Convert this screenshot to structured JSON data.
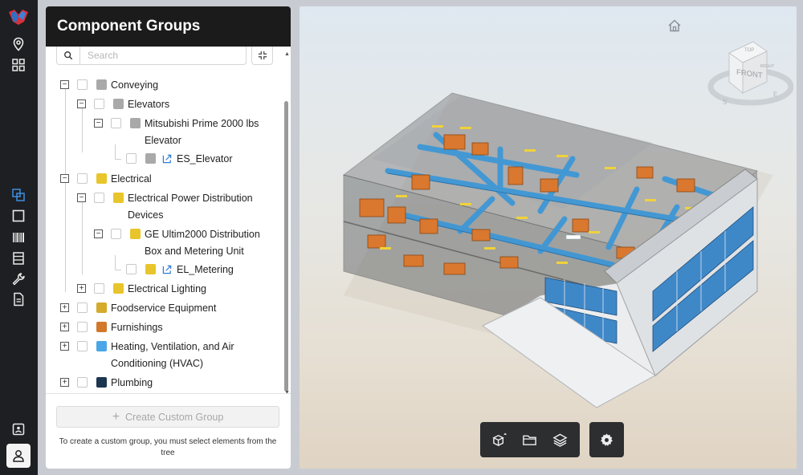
{
  "panel": {
    "title": "Component Groups",
    "search_placeholder": "Search",
    "create_button_label": "Create Custom Group",
    "hint": "To create a custom group, you must select elements from the tree"
  },
  "tree": [
    {
      "id": "conveying",
      "label": "Conveying",
      "toggle": "−",
      "color": "#a9a9a9"
    },
    {
      "id": "elevators",
      "label": "Elevators",
      "toggle": "−",
      "color": "#a9a9a9"
    },
    {
      "id": "mitsubishi",
      "label": "Mitsubishi Prime 2000 lbs",
      "label2": "Elevator",
      "toggle": "−",
      "color": "#a9a9a9"
    },
    {
      "id": "es-elevator",
      "label": "ES_Elevator",
      "color": "#a9a9a9",
      "icon": "external-link-icon"
    },
    {
      "id": "electrical",
      "label": "Electrical",
      "toggle": "−",
      "color": "#e8c52b"
    },
    {
      "id": "epdd",
      "label": "Electrical Power Distribution",
      "label2": "Devices",
      "toggle": "−",
      "color": "#e8c52b"
    },
    {
      "id": "ge",
      "label": "GE Ultim2000 Distribution",
      "label2": "Box and Metering Unit",
      "toggle": "−",
      "color": "#e8c52b"
    },
    {
      "id": "el-metering",
      "label": "EL_Metering",
      "color": "#e8c52b",
      "icon": "external-link-icon"
    },
    {
      "id": "lighting",
      "label": "Electrical Lighting",
      "toggle": "+",
      "color": "#e8c52b"
    },
    {
      "id": "foodservice",
      "label": "Foodservice Equipment",
      "toggle": "+",
      "color": "#d4ab2b"
    },
    {
      "id": "furnishings",
      "label": "Furnishings",
      "toggle": "+",
      "color": "#d2782a"
    },
    {
      "id": "hvac",
      "label": "Heating, Ventilation, and Air",
      "label2": "Conditioning (HVAC)",
      "toggle": "+",
      "color": "#4aa6e6"
    },
    {
      "id": "plumbing",
      "label": "Plumbing",
      "toggle": "+",
      "color": "#1c3550"
    }
  ],
  "rail_icons": [
    "logo-icon",
    "location-pin-icon",
    "grid-icon",
    "layers-group-icon",
    "square-icon",
    "barcode-icon",
    "table-icon",
    "wrench-icon",
    "document-icon",
    "id-card-icon",
    "user-icon"
  ],
  "viewer": {
    "navcube_faces": {
      "front": "FRONT",
      "top": "TOP",
      "right": "RIGHT"
    },
    "compass": {
      "s": "S",
      "e": "E"
    },
    "toolbar_icons": [
      "model-explode-icon",
      "folder-icon",
      "layers-icon"
    ],
    "settings_icon": "gear-icon"
  }
}
